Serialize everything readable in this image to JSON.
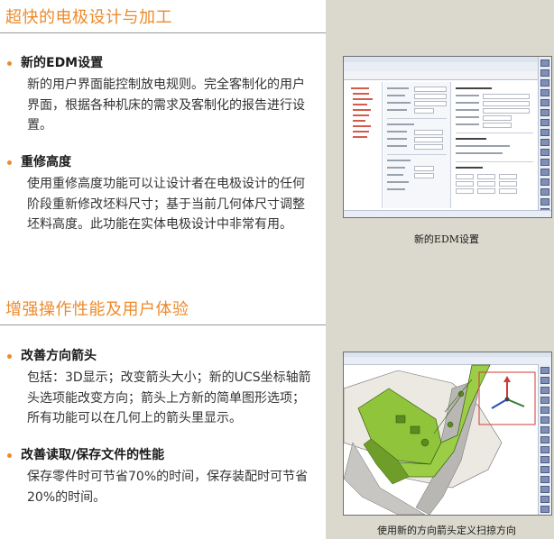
{
  "sections": {
    "electrode": {
      "title": "超快的电极设计与加工",
      "items": [
        {
          "heading": "新的EDM设置",
          "body": "新的用户界面能控制放电规则。完全客制化的用户界面，根据各种机床的需求及客制化的报告进行设置。"
        },
        {
          "heading": "重修高度",
          "body": "使用重修高度功能可以让设计者在电极设计的任何阶段重新修改坯料尺寸；基于当前几何体尺寸调整坯料高度。此功能在实体电极设计中非常有用。"
        }
      ],
      "figure_caption": "新的EDM设置"
    },
    "performance": {
      "title": "增强操作性能及用户体验",
      "items": [
        {
          "heading": "改善方向箭头",
          "body": "包括：3D显示；改变箭头大小；新的UCS坐标轴箭头选项能改变方向；箭头上方新的简单图形选项；所有功能可以在几何上的箭头里显示。"
        },
        {
          "heading": "改善读取/保存文件的性能",
          "body": "保存零件时可节省70%的时间，保存装配时可节省20%的时间。"
        }
      ],
      "figure_caption": "使用新的方向箭头定义扫掠方向"
    }
  },
  "colors": {
    "accent": "#ee8a2a",
    "panel": "#dbd9cd",
    "model_green": "#8fc43b"
  },
  "icons": [
    "bullet-dot-icon",
    "triad-axis-icon"
  ]
}
